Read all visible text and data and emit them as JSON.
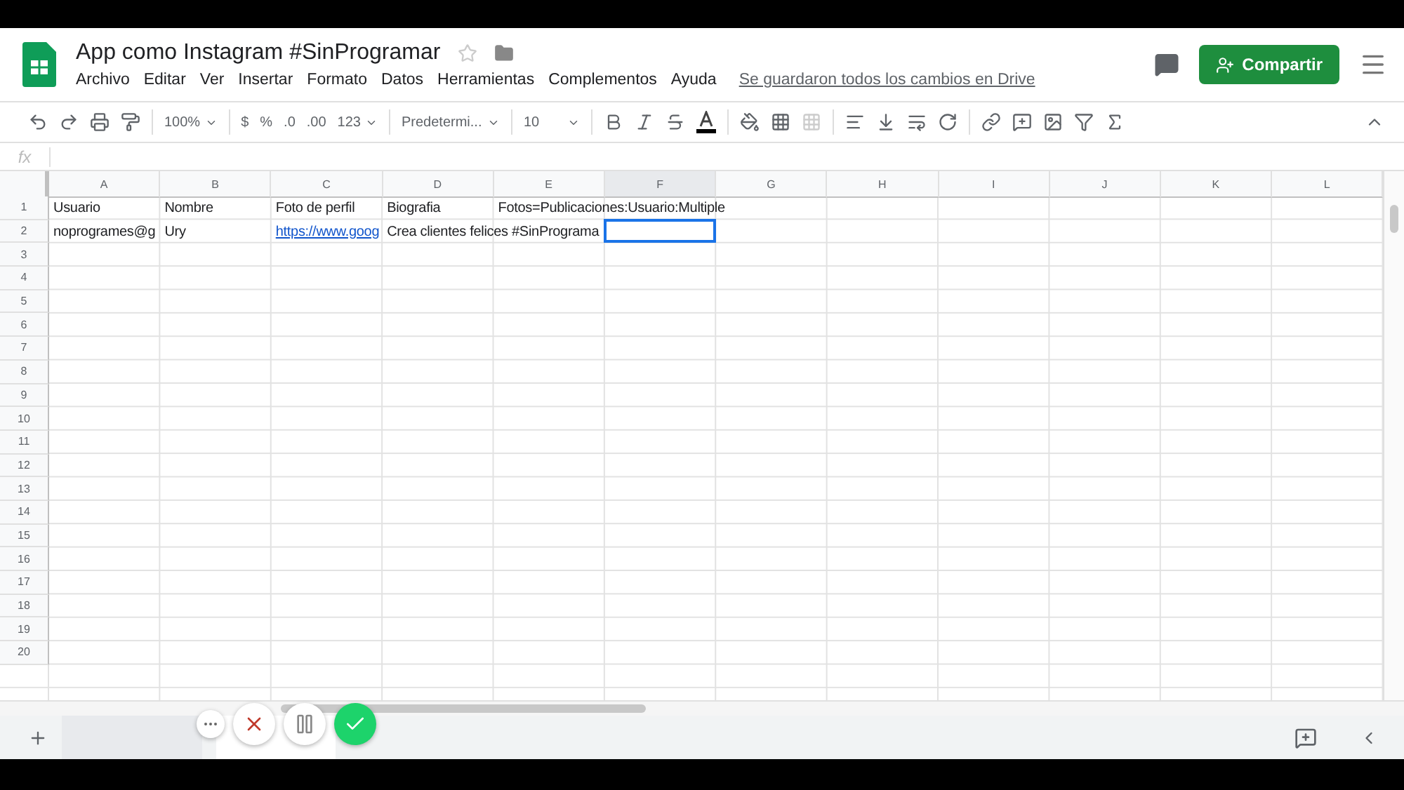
{
  "document": {
    "title": "App como Instagram #SinProgramar",
    "starred": false,
    "save_status": "Se guardaron todos los cambios en Drive"
  },
  "menu": [
    "Archivo",
    "Editar",
    "Ver",
    "Insertar",
    "Formato",
    "Datos",
    "Herramientas",
    "Complementos",
    "Ayuda"
  ],
  "share_button": {
    "label": "Compartir"
  },
  "toolbar": {
    "zoom": "100%",
    "currency": "$",
    "percent": "%",
    "decrease_decimals": ".0",
    "increase_decimals": ".00",
    "number_format": "123",
    "font": "Predetermi...",
    "font_size": "10"
  },
  "formula_bar": {
    "label": "fx"
  },
  "columns": [
    {
      "letter": "A",
      "selected": false
    },
    {
      "letter": "B",
      "selected": false
    },
    {
      "letter": "C",
      "selected": false
    },
    {
      "letter": "D",
      "selected": false
    },
    {
      "letter": "E",
      "selected": false
    },
    {
      "letter": "F",
      "selected": true
    },
    {
      "letter": "G",
      "selected": false
    },
    {
      "letter": "H",
      "selected": false
    },
    {
      "letter": "I",
      "selected": false
    },
    {
      "letter": "J",
      "selected": false
    },
    {
      "letter": "K",
      "selected": false
    },
    {
      "letter": "L",
      "selected": false
    }
  ],
  "rows": [
    {
      "number": "1",
      "cells": [
        {
          "text": "Usuario"
        },
        {
          "text": "Nombre"
        },
        {
          "text": "Foto de perfil"
        },
        {
          "text": "Biografia"
        },
        {
          "text": "Fotos=Publicaciones:Usuario:Multiple"
        },
        {},
        {},
        {},
        {},
        {},
        {},
        {}
      ]
    },
    {
      "number": "2",
      "cells": [
        {
          "text": "noprogrames@g"
        },
        {
          "text": "Ury"
        },
        {
          "text": "https://www.goog",
          "kind": "link"
        },
        {
          "text": "Crea clientes felices #SinPrograma"
        },
        {},
        {
          "selected": true
        },
        {},
        {},
        {},
        {},
        {},
        {}
      ]
    },
    {
      "number": "3"
    },
    {
      "number": "4"
    },
    {
      "number": "5"
    },
    {
      "number": "6"
    },
    {
      "number": "7"
    },
    {
      "number": "8"
    },
    {
      "number": "9"
    },
    {
      "number": "10"
    },
    {
      "number": "11"
    },
    {
      "number": "12"
    },
    {
      "number": "13"
    },
    {
      "number": "14"
    },
    {
      "number": "15"
    },
    {
      "number": "16"
    },
    {
      "number": "17"
    },
    {
      "number": "18"
    },
    {
      "number": "19"
    },
    {
      "number": "20"
    }
  ]
}
